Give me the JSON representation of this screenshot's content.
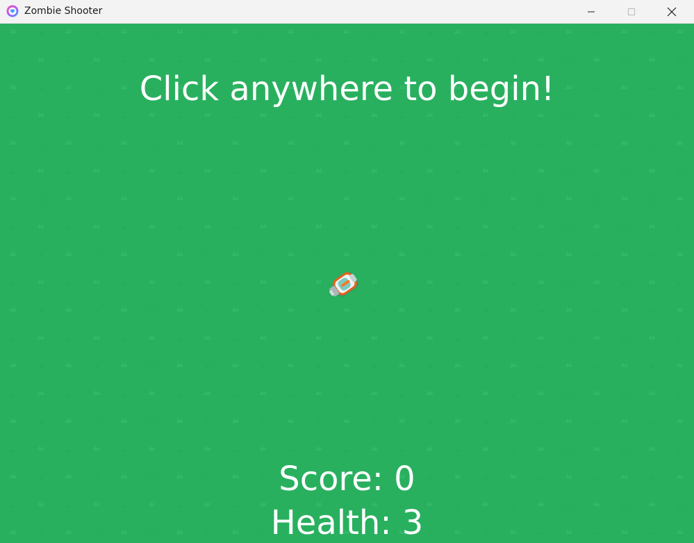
{
  "window": {
    "title": "Zombie Shooter",
    "app_icon": "heart-bubble-icon",
    "controls": {
      "minimize_icon": "minimize-icon",
      "maximize_icon": "maximize-icon",
      "close_icon": "close-icon"
    }
  },
  "game": {
    "background_color": "#29b05f",
    "prompt": "Click anywhere to begin!",
    "score_text": "Score: 0",
    "health_text": "Health: 3",
    "player_icon": "player-ship-icon"
  }
}
